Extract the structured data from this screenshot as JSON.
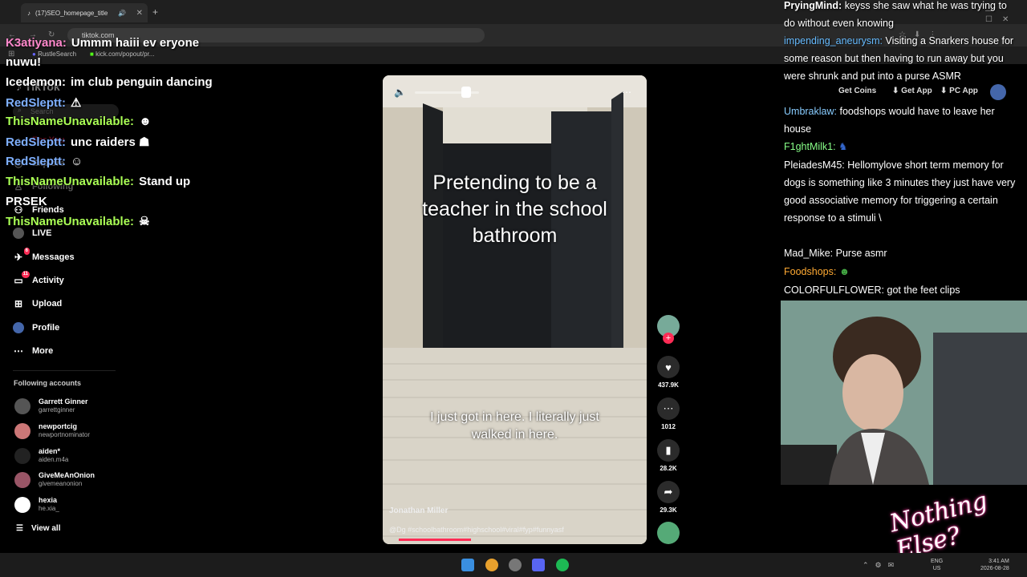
{
  "browser": {
    "tab_title": "(17)SEO_homepage_title",
    "url": "tiktok.com",
    "bookmarks": [
      "RustleSearch",
      "kick.com/popout/pr..."
    ]
  },
  "tiktok": {
    "logo": "TikTok",
    "search_placeholder": "Search",
    "nav": [
      {
        "label": "For You",
        "icon": "home-icon"
      },
      {
        "label": "Explore",
        "icon": "compass-icon"
      },
      {
        "label": "Following",
        "icon": "following-icon"
      },
      {
        "label": "Friends",
        "icon": "friends-icon"
      },
      {
        "label": "LIVE",
        "icon": "live-icon"
      },
      {
        "label": "Messages",
        "icon": "messages-icon",
        "badge": "6"
      },
      {
        "label": "Activity",
        "icon": "activity-icon",
        "badge": "11"
      },
      {
        "label": "Upload",
        "icon": "upload-icon"
      },
      {
        "label": "Profile",
        "icon": "profile-icon"
      },
      {
        "label": "More",
        "icon": "more-icon"
      }
    ],
    "following_header": "Following accounts",
    "accounts": [
      {
        "name": "Garrett Ginner",
        "handle": "garrettginner"
      },
      {
        "name": "newportcig",
        "handle": "newportnominator"
      },
      {
        "name": "aiden*",
        "handle": "aiden.m4a"
      },
      {
        "name": "GiveMeAnOnion",
        "handle": "givemeanonion"
      },
      {
        "name": "hexia",
        "handle": "he.xia_"
      }
    ],
    "view_all": "View all",
    "top_right": {
      "get_coins": "Get Coins",
      "get_app": "Get App",
      "pc_app": "PC App"
    },
    "video": {
      "caption": "Pretending to be a teacher in the school bathroom",
      "subtitle": "I just got in here. I literally just walked in here.",
      "author": "Jonathan Miller",
      "tags": "@Dg #schoolbathroom#highschool#viral#fyp#funnyasf"
    },
    "actions": {
      "likes": "437.9K",
      "comments": "1012",
      "saves": "28.2K",
      "shares": "29.3K"
    }
  },
  "left_chat": [
    {
      "user": "K3atiyana:",
      "text": "Ummm haiii ev eryone",
      "color": "#ff88cc"
    },
    {
      "user": "",
      "text": "nuwu!",
      "color": "#ffffff"
    },
    {
      "user": "Icedemon:",
      "text": "im club penguin dancing",
      "color": "#ffffff"
    },
    {
      "user": "RedSleptt:",
      "text": "",
      "color": "#7fb0ff"
    },
    {
      "user": "ThisNameUnavailable:",
      "text": "",
      "color": "#aaff55"
    },
    {
      "user": "RedSleptt:",
      "text": "unc raiders",
      "color": "#7fb0ff"
    },
    {
      "user": "RedSleptt:",
      "text": "",
      "color": "#7fb0ff"
    },
    {
      "user": "ThisNameUnavailable:",
      "text": "Stand up",
      "color": "#aaff55"
    },
    {
      "user": "",
      "text": "PRSEK",
      "color": "#ffffff"
    },
    {
      "user": "ThisNameUnavailable:",
      "text": "",
      "color": "#aaff55"
    }
  ],
  "right_chat": [
    {
      "user": "PryingMind:",
      "text": "keyss she saw what he was trying to do without even knowing",
      "color": "#ffffff"
    },
    {
      "user": "impending_aneurysm:",
      "text": "Visiting a Snarkers house for some reason but then having to run away but you were shrunk and put into a purse ASMR",
      "color": "#66bbff"
    },
    {
      "user": "Umbraklaw:",
      "text": "foodshops would have to leave her house",
      "color": "#88ccff"
    },
    {
      "user": "F1ghtMilk1:",
      "text": "",
      "color": "#88ff88"
    },
    {
      "user": "PleiadesM45:",
      "text": "Hellomylove short term memory for dogs is something like 3 minutes they just have very good associative memory for triggering a certain response to a stimuli \\",
      "color": "#ffffff"
    },
    {
      "user": "Mad_Mike:",
      "text": "Purse asmr",
      "color": "#ffffff"
    },
    {
      "user": "Foodshops:",
      "text": "",
      "color": "#ffaa33"
    },
    {
      "user": "COLORFULFLOWER:",
      "text": "got the feet clips",
      "color": "#ffffff"
    }
  ],
  "overlay_logo": "Nothing Else?",
  "taskbar": {
    "lang": "ENG",
    "region": "US",
    "time": "3:41 AM",
    "date": "2026-08-28"
  }
}
